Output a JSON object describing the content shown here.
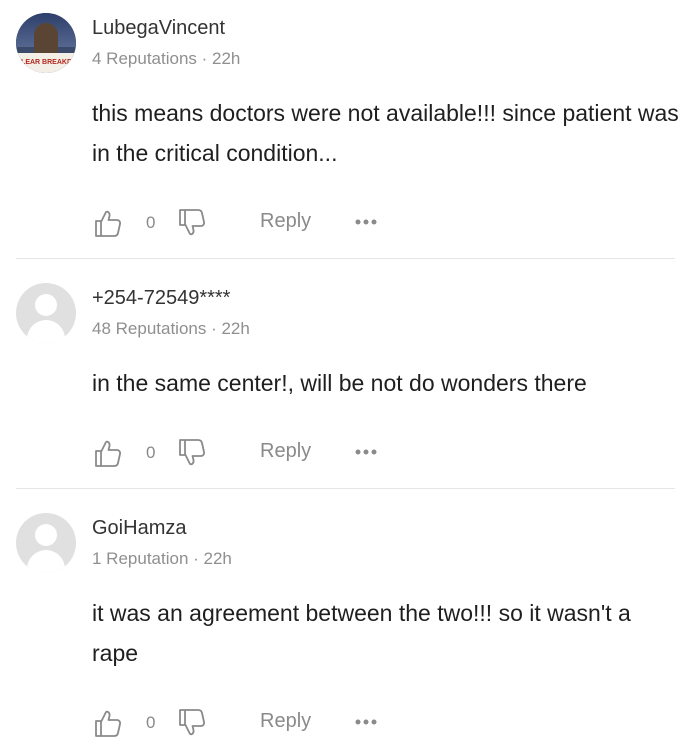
{
  "comments": [
    {
      "username": "LubegaVincent",
      "meta": "4 Reputations · 22h",
      "text": "this means doctors were not available!!! since patient was in the critical condition...",
      "avatar_type": "photo",
      "avatar_banner": "CLEAR BREAKDOWN",
      "likes": "0",
      "reply_label": "Reply",
      "like_icon": "thumbs-up-icon",
      "dislike_icon": "thumbs-down-icon",
      "more_icon": "more-dots-icon"
    },
    {
      "username": "+254-72549****",
      "meta": "48 Reputations · 22h",
      "text": "in the same center!, will be not do wonders there",
      "avatar_type": "default",
      "likes": "0",
      "reply_label": "Reply",
      "like_icon": "thumbs-up-icon",
      "dislike_icon": "thumbs-down-icon",
      "more_icon": "more-dots-icon"
    },
    {
      "username": "GoiHamza",
      "meta": "1 Reputation · 22h",
      "text": "it was an agreement between the two!!! so it wasn't a rape",
      "avatar_type": "default",
      "likes": "0",
      "reply_label": "Reply",
      "like_icon": "thumbs-up-icon",
      "dislike_icon": "thumbs-down-icon",
      "more_icon": "more-dots-icon"
    }
  ],
  "colors": {
    "text_primary": "#1f1f1f",
    "text_secondary": "#8f8f8f",
    "icon": "#8a8a8a",
    "divider": "#e6e6e6",
    "avatar_default": "#e0e0e0"
  }
}
